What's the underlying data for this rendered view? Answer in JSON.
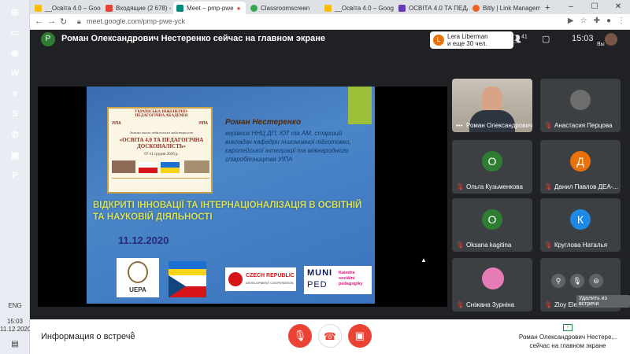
{
  "taskbar": {
    "icons": [
      {
        "name": "start-icon",
        "color": "#2b579a",
        "glyph": "⊞"
      },
      {
        "name": "file-explorer-icon",
        "color": "#f2c12e",
        "glyph": "▭"
      },
      {
        "name": "chrome-icon",
        "color": "#db4437",
        "glyph": "◉"
      },
      {
        "name": "word-icon",
        "color": "#2b579a",
        "glyph": "W"
      },
      {
        "name": "edge-icon",
        "color": "#0078d7",
        "glyph": "e"
      },
      {
        "name": "skype-icon",
        "color": "#00aff0",
        "glyph": "S"
      },
      {
        "name": "viber-icon",
        "color": "#7360f2",
        "glyph": "✆"
      },
      {
        "name": "store-icon",
        "color": "#0078d7",
        "glyph": "▣"
      },
      {
        "name": "powerpoint-icon",
        "color": "#d24726",
        "glyph": "P"
      }
    ],
    "lang": "ENG",
    "time": "15:03",
    "date": "11.12.2020"
  },
  "browser": {
    "tabs": [
      {
        "label": "__Освіта 4.0 – Goog",
        "color": "#fbbc04"
      },
      {
        "label": "Входящие (2 678) - E",
        "color": "#ea4335"
      },
      {
        "label": "Meet – pmp-pwe",
        "color": "#00897b"
      },
      {
        "label": "Classroomscreen",
        "color": "#34a853"
      },
      {
        "label": "__Освіта 4.0 – Goog",
        "color": "#fbbc04"
      },
      {
        "label": "ОСВІТА 4.0 ТА ПЕДАГ",
        "color": "#673ab7"
      },
      {
        "label": "Bitly | Link Managem",
        "color": "#ee6123"
      }
    ],
    "url": "meet.google.com/pmp-pwe-yck"
  },
  "meet": {
    "presenter_initial": "Р",
    "presenting_title": "Роман Олександрович Нестеренко сейчас на главном экране",
    "joiners_line1": "Lera Liberman",
    "joiners_line2": "и еще 30 чел.",
    "joiners_initial": "L",
    "people_count": "41",
    "time": "15:03",
    "me_label": "Вы"
  },
  "slide": {
    "poster_lines": [
      "УКРАЇНСЬКА ІНЖЕНЕРНО-ПЕДАГОГІЧНА АКАДЕМІЯ",
      "Зимова школа педагогічної майстерності",
      "«ОСВІТА 4.0 ТА ПЕДАГОГІЧНА ДОСКОНАЛІСТЬ»",
      "07-11 грудня 2020 р."
    ],
    "poster_logo_left": "УІПА",
    "poster_logo_right": "УІПА",
    "name": "Роман Нестеренко",
    "role": "керівник ННЦ ДП, ЮТ та АМ, старший викладач кафедри іншомовної підготовки, європейської інтеграції та міжнародного співробітництва УІПА",
    "heading": "ВІДКРИТІ ІННОВАЦІЇ ТА ІНТЕРНАЦІОНАЛІЗАЦІЯ В ОСВІТНІЙ ТА НАУКОВІЙ ДІЯЛЬНОСТІ",
    "date": "11.12.2020",
    "logo_uepa": "UEPA",
    "logo_czech": "CZECH REPUBLIC",
    "logo_czech_sub": "DEVELOPMENT COOPERATION",
    "logo_muni": "MUNI",
    "logo_ped": "PED",
    "logo_katedra": "Katedra sociální pedagogiky"
  },
  "participants": [
    {
      "name": "Роман Олександрович...",
      "type": "video"
    },
    {
      "name": "Анастасия Перцова",
      "type": "photo"
    },
    {
      "name": "Ольга Кузьменкова",
      "initial": "О",
      "color": "#2e7d32"
    },
    {
      "name": "Данил Павлов ДЕА-...",
      "initial": "Д",
      "color": "#e8710a"
    },
    {
      "name": "Oksana kagitina",
      "initial": "O",
      "color": "#2e7d32"
    },
    {
      "name": "Круглова Наталья",
      "initial": "К",
      "color": "#1e88e5"
    },
    {
      "name": "Сніжана Зурніна",
      "type": "photo2"
    },
    {
      "name": "Zloy Elen Alexandrova",
      "type": "blank"
    }
  ],
  "tile_tooltip": "Удалить из встречи",
  "bottom": {
    "info_label": "Информация о встрече",
    "presenting_line1": "Роман Олександрович Нестерe...",
    "presenting_line2": "сейчас на главном экране"
  },
  "colors": {
    "meet_bg": "#202124",
    "end_call_red": "#ea4335",
    "off_button_red": "#ea4335"
  }
}
